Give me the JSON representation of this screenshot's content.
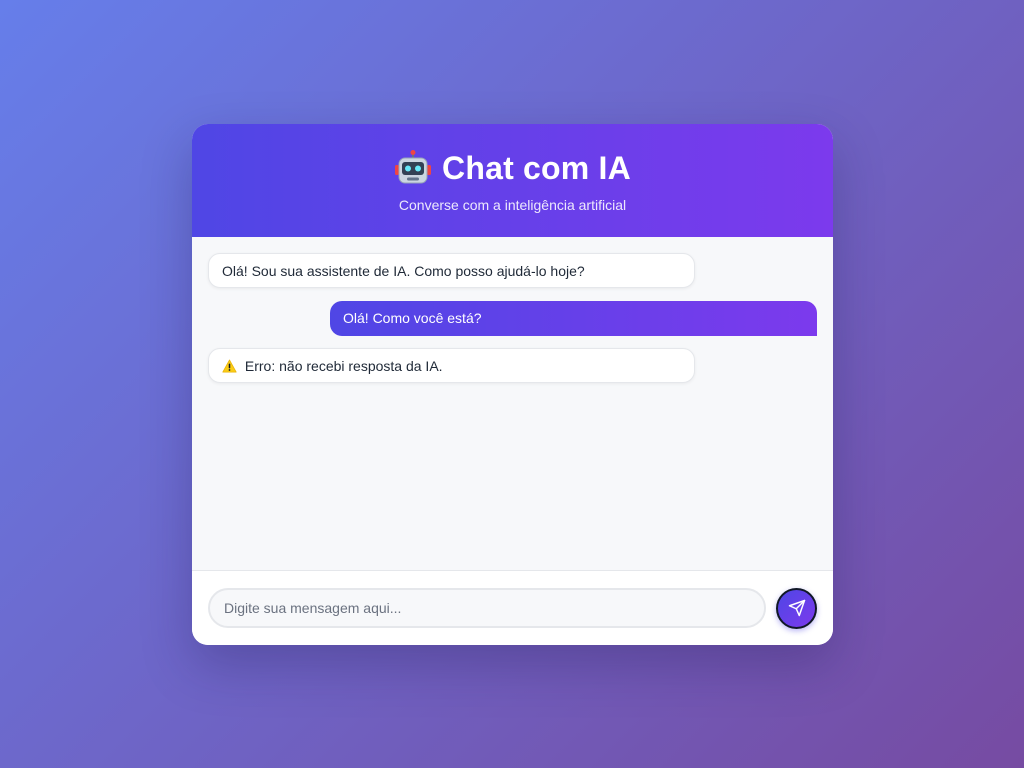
{
  "header": {
    "title": "Chat com IA",
    "subtitle": "Converse com a inteligência artificial",
    "icon": "robot-icon"
  },
  "messages": [
    {
      "sender": "bot",
      "text": "Olá! Sou sua assistente de IA. Como posso ajudá-lo hoje?"
    },
    {
      "sender": "user",
      "text": "Olá! Como você está?"
    },
    {
      "sender": "bot",
      "icon": "warning-icon",
      "text": "Erro: não recebi resposta da IA."
    }
  ],
  "composer": {
    "placeholder": "Digite sua mensagem aqui...",
    "value": "",
    "send_icon": "send-icon"
  },
  "colors": {
    "accent_start": "#4f46e5",
    "accent_end": "#7c3aed",
    "background_start": "#667eea",
    "background_end": "#764ba2"
  }
}
